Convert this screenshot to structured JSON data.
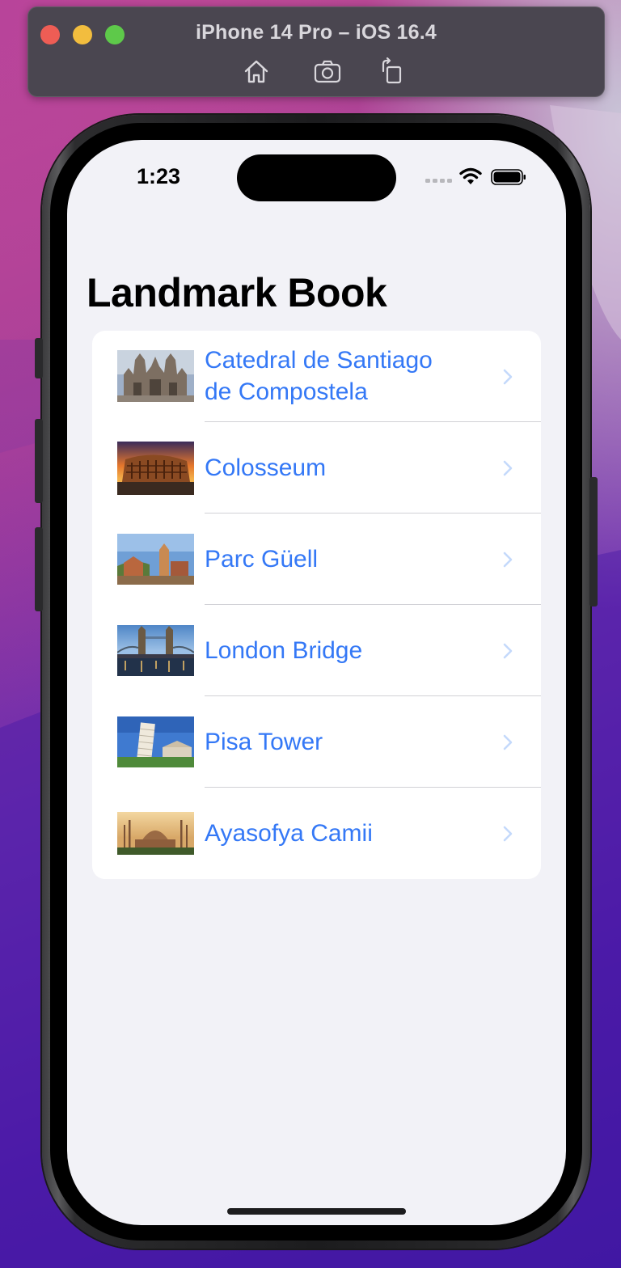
{
  "simulator": {
    "title": "iPhone 14 Pro – iOS 16.4",
    "tools": [
      "home-icon",
      "screenshot-icon",
      "rotate-icon"
    ]
  },
  "status_bar": {
    "time": "1:23"
  },
  "screen": {
    "title": "Landmark Book",
    "items": [
      {
        "label": "Catedral de Santiago de Compostela",
        "image": "cathedral-photo"
      },
      {
        "label": "Colosseum",
        "image": "colosseum-photo"
      },
      {
        "label": "Parc Güell",
        "image": "parc-guell-photo"
      },
      {
        "label": "London Bridge",
        "image": "london-bridge-photo"
      },
      {
        "label": "Pisa Tower",
        "image": "pisa-tower-photo"
      },
      {
        "label": "Ayasofya Camii",
        "image": "ayasofya-photo"
      }
    ]
  },
  "colors": {
    "accent": "#3478f6",
    "background": "#f2f2f7",
    "chevron": "#c4d9fb"
  }
}
